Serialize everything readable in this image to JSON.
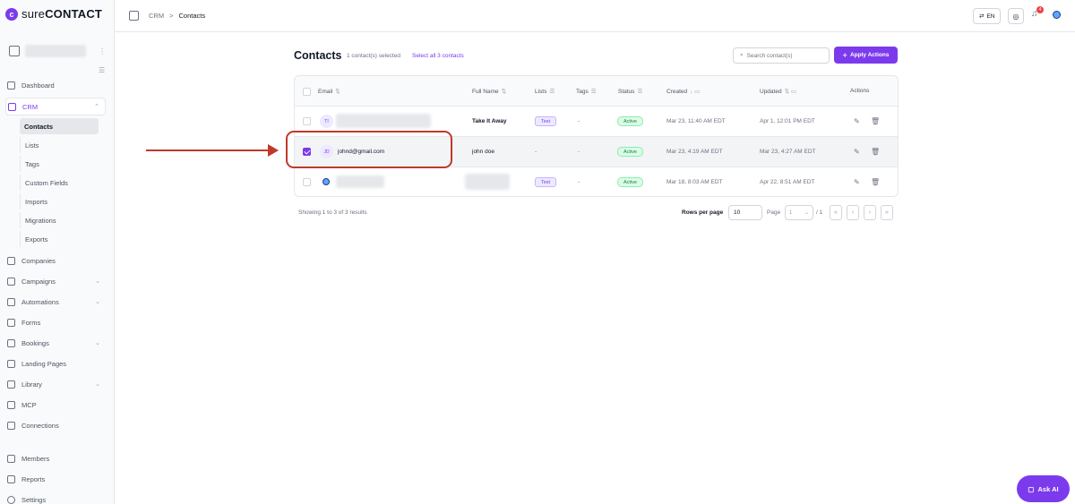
{
  "brand": {
    "prefix": "sure",
    "suffix": "CONTACT"
  },
  "topbar": {
    "breadcrumb_root": "CRM",
    "breadcrumb_sep": ">",
    "breadcrumb_current": "Contacts",
    "lang_label": "EN",
    "notification_count": "4"
  },
  "sidebar": {
    "items": [
      {
        "label": "Dashboard",
        "icon": "dashboard-icon"
      },
      {
        "label": "CRM",
        "icon": "crm-icon",
        "expanded": true
      },
      {
        "label": "Companies",
        "icon": "building-icon"
      },
      {
        "label": "Campaigns",
        "icon": "megaphone-icon"
      },
      {
        "label": "Automations",
        "icon": "automation-icon"
      },
      {
        "label": "Forms",
        "icon": "form-icon"
      },
      {
        "label": "Bookings",
        "icon": "calendar-icon"
      },
      {
        "label": "Landing Pages",
        "icon": "page-icon"
      },
      {
        "label": "Library",
        "icon": "library-icon"
      },
      {
        "label": "MCP",
        "icon": "mcp-icon"
      },
      {
        "label": "Connections",
        "icon": "plug-icon"
      },
      {
        "label": "Members",
        "icon": "users-icon"
      },
      {
        "label": "Reports",
        "icon": "chart-icon"
      },
      {
        "label": "Settings",
        "icon": "gear-icon"
      }
    ],
    "crm_sub": [
      "Contacts",
      "Lists",
      "Tags",
      "Custom Fields",
      "Imports",
      "Migrations",
      "Exports"
    ]
  },
  "main": {
    "title": "Contacts",
    "selected_text": "1 contact(s) selected",
    "select_all": "Select all 3 contacts",
    "search_placeholder": "Search contact(s)",
    "apply_label": "Apply Actions",
    "columns": [
      "Email",
      "Full Name",
      "Lists",
      "Tags",
      "Status",
      "Created",
      "Updated",
      "Actions"
    ],
    "rows": [
      {
        "initials": "TI",
        "email": "",
        "full_name": "Take It Away",
        "list": "Test",
        "tags": "-",
        "status": "Active",
        "created": "Mar 23, 11:40 AM EDT",
        "updated": "Apr 1, 12:01 PM EDT",
        "selected": false
      },
      {
        "initials": "JD",
        "email": "johnd@gmail.com",
        "full_name": "john doe",
        "list": "-",
        "tags": "-",
        "status": "Active",
        "created": "Mar 23, 4:19 AM EDT",
        "updated": "Mar 23, 4:27 AM EDT",
        "selected": true
      },
      {
        "initials": "",
        "email": "",
        "full_name": "",
        "list": "Test",
        "tags": "-",
        "status": "Active",
        "created": "Mar 18, 8:03 AM EDT",
        "updated": "Apr 22, 8:51 AM EDT",
        "selected": false
      }
    ],
    "showing": "Showing 1 to 3 of 3 results",
    "rows_per_page_label": "Rows per page",
    "rows_per_page": "10",
    "page_label": "Page",
    "page_value": "1",
    "page_total": "/ 1"
  },
  "ask_ai": "Ask AI",
  "colors": {
    "accent": "#7c3aed",
    "annotation": "#c0392b",
    "active_green": "#15803d"
  }
}
